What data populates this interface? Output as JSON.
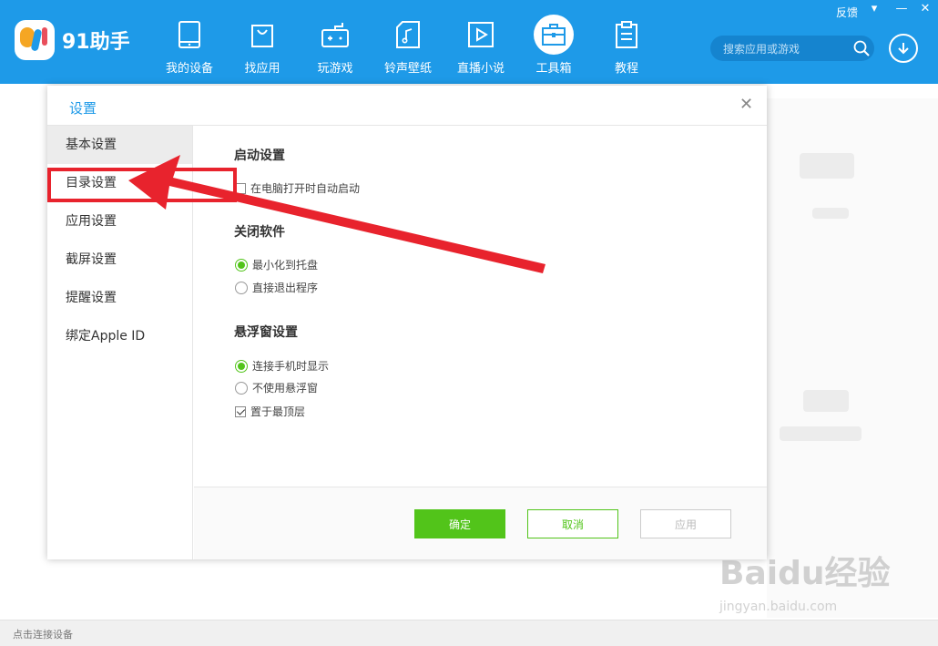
{
  "app": {
    "logo_text": "91助手",
    "feedback": "反馈",
    "search_placeholder": "搜索应用或游戏",
    "nav": [
      {
        "label": "我的设备",
        "icon": "tablet-icon"
      },
      {
        "label": "找应用",
        "icon": "shopping-bag-icon"
      },
      {
        "label": "玩游戏",
        "icon": "gamepad-icon"
      },
      {
        "label": "铃声壁纸",
        "icon": "music-file-icon"
      },
      {
        "label": "直播小说",
        "icon": "play-icon"
      },
      {
        "label": "工具箱",
        "icon": "toolbox-icon"
      },
      {
        "label": "教程",
        "icon": "clipboard-icon"
      }
    ],
    "active_nav": "工具箱",
    "status_text": "点击连接设备",
    "accent_color": "#1e9ae8"
  },
  "dialog": {
    "title": "设置",
    "sidebar": [
      {
        "label": "基本设置"
      },
      {
        "label": "目录设置"
      },
      {
        "label": "应用设置"
      },
      {
        "label": "截屏设置"
      },
      {
        "label": "提醒设置"
      },
      {
        "label": "绑定Apple ID"
      }
    ],
    "active_sidebar": "基本设置",
    "highlighted_sidebar": "目录设置",
    "sections": {
      "startup": {
        "title": "启动设置",
        "auto_start": {
          "label": "在电脑打开时自动启动",
          "checked": false
        }
      },
      "close": {
        "title": "关闭软件",
        "minimize": {
          "label": "最小化到托盘",
          "checked": true
        },
        "exit": {
          "label": "直接退出程序",
          "checked": false
        }
      },
      "float": {
        "title": "悬浮窗设置",
        "show_on_connect": {
          "label": "连接手机时显示",
          "checked": true
        },
        "no_float": {
          "label": "不使用悬浮窗",
          "checked": false
        },
        "always_top": {
          "label": "置于最顶层",
          "checked": true
        }
      }
    },
    "buttons": {
      "ok": "确定",
      "cancel": "取消",
      "apply": "应用"
    },
    "ok_color": "#52c41a"
  },
  "watermark": {
    "brand": "Baidu经验",
    "url": "jingyan.baidu.com"
  }
}
